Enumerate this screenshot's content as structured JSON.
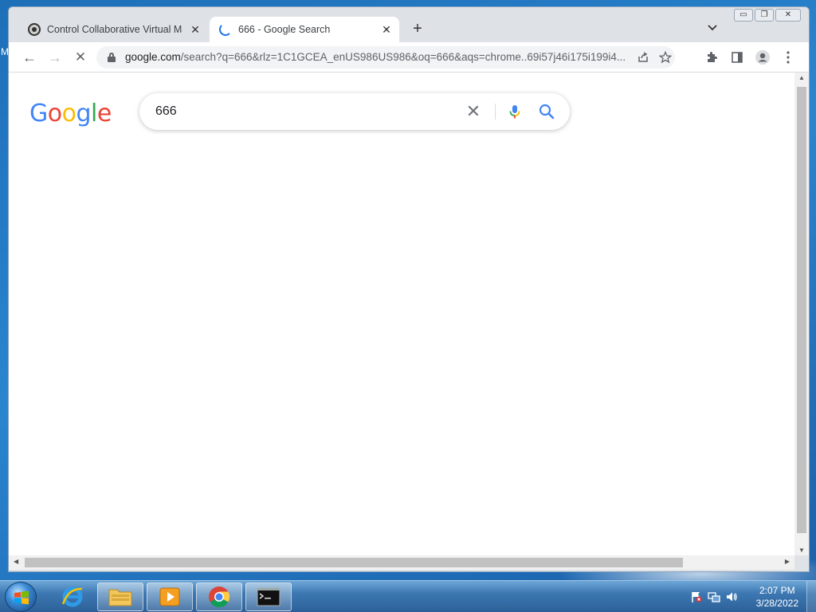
{
  "desktop": {
    "edge_letter": "M"
  },
  "browser": {
    "tabs": [
      {
        "title": "Control Collaborative Virtual Ma",
        "icon": "vm-favicon-icon",
        "active": false
      },
      {
        "title": "666 - Google Search",
        "icon": "loading-spinner-icon",
        "active": true
      }
    ],
    "tab_close_glyph": "✕",
    "new_tab_glyph": "+",
    "window_controls": {
      "minimize": "▭",
      "restore": "❐",
      "close": "✕"
    },
    "toolbar": {
      "back_glyph": "←",
      "forward_glyph": "→",
      "stop_glyph": "✕",
      "url_host": "google.com",
      "url_path": "/search?q=666&rlz=1C1GCEA_enUS986US986&oq=666&aqs=chrome..69i57j46i175i199i4..."
    }
  },
  "page": {
    "logo_letters": [
      {
        "ch": "G",
        "color": "#4285F4"
      },
      {
        "ch": "o",
        "color": "#EA4335"
      },
      {
        "ch": "o",
        "color": "#FBBC05"
      },
      {
        "ch": "g",
        "color": "#4285F4"
      },
      {
        "ch": "l",
        "color": "#34A853"
      },
      {
        "ch": "e",
        "color": "#EA4335"
      }
    ],
    "search_value": "666",
    "clear_glyph": "✕"
  },
  "taskbar": {
    "items": [
      "start-button",
      "internet-explorer",
      "file-explorer",
      "media-player",
      "chrome",
      "command-prompt"
    ],
    "clock_time": "2:07 PM",
    "clock_date": "3/28/2022"
  },
  "colors": {
    "accent": "#1a73e8",
    "taskbar": "#2d6098"
  }
}
